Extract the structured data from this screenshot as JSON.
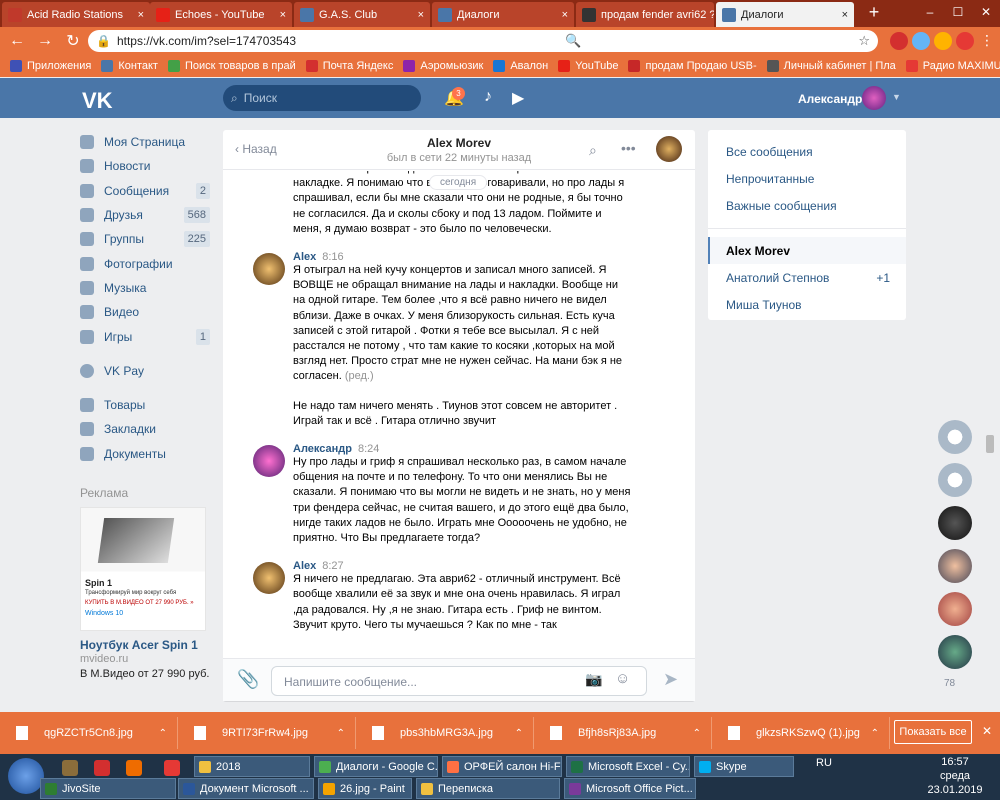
{
  "browser": {
    "tabs": [
      {
        "title": "Acid Radio Stations",
        "icon_color": "#c0392b"
      },
      {
        "title": "Echoes - YouTube",
        "icon_color": "#e62117"
      },
      {
        "title": "G.A.S. Club",
        "icon_color": "#4a76a8"
      },
      {
        "title": "Диалоги",
        "icon_color": "#4a76a8"
      },
      {
        "title": "продам fender avri62 ?",
        "icon_color": "#333333"
      },
      {
        "title": "Диалоги",
        "icon_color": "#4a76a8"
      }
    ],
    "url": "https://vk.com/im?sel=174703543",
    "bookmarks": [
      "Приложения",
      "Контакт",
      "Поиск товаров в прай",
      "Почта Яндекс",
      "Аэромьюзик",
      "Авалон",
      "YouTube",
      "продам Продаю USB-",
      "Личный кабинет | Пла",
      "Радио MAXIMUM! ЕС/"
    ],
    "ext_badge": "3"
  },
  "vk": {
    "logo": "VK",
    "search_placeholder": "Поиск",
    "notif_count": "3",
    "user_name": "Александр"
  },
  "left_nav": {
    "items": [
      {
        "label": "Моя Страница",
        "count": ""
      },
      {
        "label": "Новости",
        "count": ""
      },
      {
        "label": "Сообщения",
        "count": "2"
      },
      {
        "label": "Друзья",
        "count": "568"
      },
      {
        "label": "Группы",
        "count": "225"
      },
      {
        "label": "Фотографии",
        "count": ""
      },
      {
        "label": "Музыка",
        "count": ""
      },
      {
        "label": "Видео",
        "count": ""
      },
      {
        "label": "Игры",
        "count": "1"
      }
    ],
    "vkpay": "VK Pay",
    "items2": [
      {
        "label": "Товары"
      },
      {
        "label": "Закладки"
      },
      {
        "label": "Документы"
      }
    ],
    "ads_label": "Реклама",
    "ad": {
      "image_title": "Spin 1",
      "image_sub": "Трансформируй мир вокруг себя",
      "image_price": "КУПИТЬ В М.ВИДЕО ОТ 27 990 РУБ. »",
      "image_win": "Windows 10",
      "title": "Ноутбук Acer Spin 1",
      "domain": "mvideo.ru",
      "text": "В М.Видео от 27 990 руб."
    }
  },
  "chat": {
    "back": "Назад",
    "contact_name": "Alex Morev",
    "status": "был в сети 22 минуты назад",
    "date_pill": "сегодня",
    "prev_text": "или больше. Кроме ладов меня больше огорчает сколы на накладке. Я понимаю что вы мне не оговаривали, но про лады я спрашивал, если бы мне сказали что они не родные, я бы точно не согласился. Да и сколы сбоку и под 13 ладом. Поймите и меня, я думаю возврат - это было по человечески.",
    "messages": [
      {
        "author": "Alex",
        "time": "8:16",
        "who": "alex",
        "texts": [
          "Я отыграл на ней кучу концертов и записал много записей. Я ВОВЩЕ не обращал внимание на лады и накладки. Вообще ни на одной гитаре. Тем более ,что я всё равно ничего не видел вблизи. Даже в очках. У меня близорукость сильная. Есть куча записей с этой гитарой . Фотки я тебе все высылал. Я с ней расстался не потому , что там какие то косяки ,которых на мой взгляд нет. Просто страт мне не нужен сейчас. На мани бэк я не согласен.",
          "Не надо там ничего менять . Тиунов этот совсем не авторитет . Играй так и всё . Гитара отлично звучит"
        ],
        "edited": "(ред.)"
      },
      {
        "author": "Александр",
        "time": "8:24",
        "who": "me",
        "texts": [
          "Ну про лады и гриф я спрашивал несколько раз, в самом начале общения на почте и по телефону. То что они менялись Вы не сказали. Я понимаю что вы могли не видеть и не знать, но у меня три фендера сейчас, не считая вашего, и до этого ещё два было, нигде таких ладов не было. Играть мне Ооооочень не удобно, не приятно. Что Вы предлагаете тогда?"
        ]
      },
      {
        "author": "Alex",
        "time": "8:27",
        "who": "alex",
        "texts": [
          "Я ничего не предлагаю. Эта аври62 - отличный инструмент. Всё вообще хвалили её за звук и мне она очень нравилась. Я играл ,да радовался. Ну ,я не знаю. Гитара есть . Гриф не винтом. Звучит круто. Чего ты мучаешься ? Как по мне - так"
        ]
      }
    ],
    "compose_placeholder": "Напишите сообщение..."
  },
  "right_nav": {
    "filters": [
      "Все сообщения",
      "Непрочитанные",
      "Важные сообщения"
    ],
    "dialogs": [
      {
        "name": "Alex Morev",
        "badge": ""
      },
      {
        "name": "Анатолий Степнов",
        "badge": "+1"
      },
      {
        "name": "Миша Тиунов",
        "badge": ""
      }
    ]
  },
  "rail_count": "78",
  "downloads": {
    "files": [
      "qgRZCTr5Cn8.jpg",
      "9RTI73FrRw4.jpg",
      "pbs3hbMRG3A.jpg",
      "Bfjh8sRj83A.jpg",
      "glkzsRKSzwQ (1).jpg"
    ],
    "show_all": "Показать все"
  },
  "taskbar": {
    "row1": [
      {
        "label": "2018",
        "color": "#f0c040"
      },
      {
        "label": "Диалоги - Google C...",
        "color": "#4caf50"
      },
      {
        "label": "ОРФЕЙ салон Hi-Fi ...",
        "color": "#ff7043"
      },
      {
        "label": "Microsoft Excel - Су...",
        "color": "#1e7145"
      },
      {
        "label": "Skype",
        "color": "#00aff0"
      }
    ],
    "row2": [
      {
        "label": "JivoSite",
        "color": "#2e7d32"
      },
      {
        "label": "Документ Microsoft ...",
        "color": "#2b579a"
      },
      {
        "label": "26.jpg - Paint",
        "color": "#f4a300"
      },
      {
        "label": "Переписка",
        "color": "#f0c040"
      },
      {
        "label": "Microsoft Office Pict...",
        "color": "#7a3a9a"
      }
    ],
    "lang": "RU",
    "time": "16:57",
    "day": "среда",
    "date": "23.01.2019"
  }
}
